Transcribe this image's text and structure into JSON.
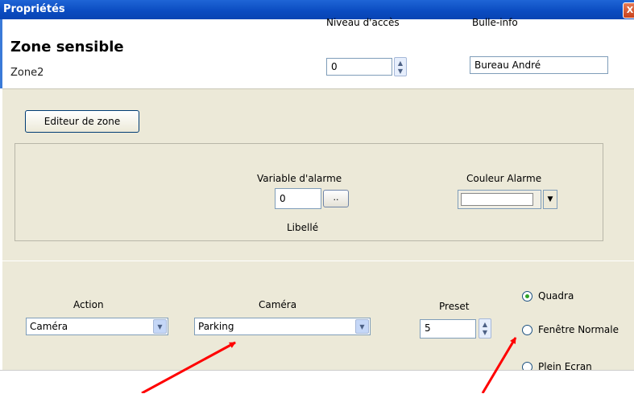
{
  "window": {
    "title": "Propriétés",
    "close_label": "X"
  },
  "header": {
    "heading": "Zone sensible",
    "subheading": "Zone2",
    "access_level": {
      "label": "Niveau d'accès",
      "value": "0"
    },
    "tooltip": {
      "label": "Bulle-info",
      "value": "Bureau André"
    }
  },
  "zone": {
    "editor_button": "Editeur de zone",
    "alarm_variable": {
      "label": "Variable d'alarme",
      "value": "0",
      "browse_label": ".."
    },
    "libelle_label": "Libellé",
    "alarm_color": {
      "label": "Couleur Alarme",
      "value": "#ffffff"
    }
  },
  "action_panel": {
    "action": {
      "label": "Action",
      "value": "Caméra"
    },
    "camera": {
      "label": "Caméra",
      "value": "Parking"
    },
    "preset": {
      "label": "Preset",
      "value": "5"
    },
    "display_modes": [
      {
        "label": "Quadra",
        "selected": true
      },
      {
        "label": "Fenêtre Normale",
        "selected": false
      },
      {
        "label": "Plein Ecran",
        "selected": false
      }
    ]
  },
  "colors": {
    "titlebar": "#0a4bc0",
    "panel": "#ece9d8",
    "arrow": "#ff0000",
    "radio_selected": "#2fa326"
  }
}
